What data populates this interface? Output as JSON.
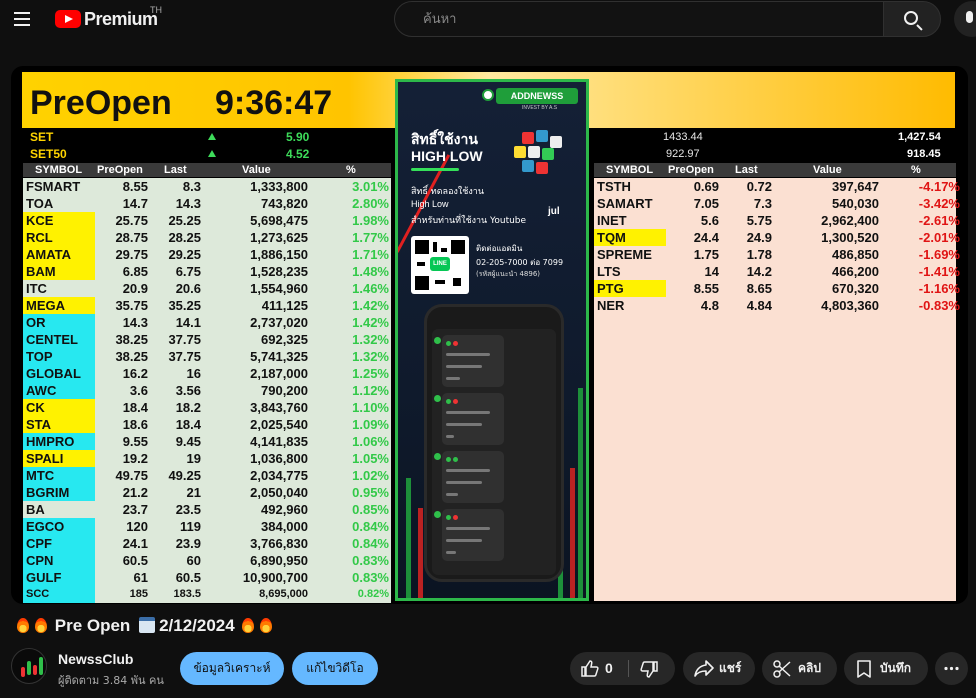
{
  "header": {
    "logo_text": "Premium",
    "region": "TH",
    "search_placeholder": "ค้นหา"
  },
  "video": {
    "banner_title": "PreOpen",
    "banner_time": "9:36:47",
    "indices": [
      {
        "name": "SET",
        "change": "5.90",
        "value": "1433.44",
        "close": "1,427.54"
      },
      {
        "name": "SET50",
        "change": "4.52",
        "value": "922.97",
        "close": "918.45"
      }
    ],
    "columns": [
      "SYMBOL",
      "PreOpen",
      "Last",
      "Value",
      "%"
    ],
    "gainers": [
      {
        "s": "FSMART",
        "p": "8.55",
        "l": "8.3",
        "v": "1,333,800",
        "c": "3.01%",
        "h": ""
      },
      {
        "s": "TOA",
        "p": "14.7",
        "l": "14.3",
        "v": "743,820",
        "c": "2.80%",
        "h": ""
      },
      {
        "s": "KCE",
        "p": "25.75",
        "l": "25.25",
        "v": "5,698,475",
        "c": "1.98%",
        "h": "yellow"
      },
      {
        "s": "RCL",
        "p": "28.75",
        "l": "28.25",
        "v": "1,273,625",
        "c": "1.77%",
        "h": "yellow"
      },
      {
        "s": "AMATA",
        "p": "29.75",
        "l": "29.25",
        "v": "1,886,150",
        "c": "1.71%",
        "h": "yellow"
      },
      {
        "s": "BAM",
        "p": "6.85",
        "l": "6.75",
        "v": "1,528,235",
        "c": "1.48%",
        "h": "yellow"
      },
      {
        "s": "ITC",
        "p": "20.9",
        "l": "20.6",
        "v": "1,554,960",
        "c": "1.46%",
        "h": ""
      },
      {
        "s": "MEGA",
        "p": "35.75",
        "l": "35.25",
        "v": "411,125",
        "c": "1.42%",
        "h": "yellow"
      },
      {
        "s": "OR",
        "p": "14.3",
        "l": "14.1",
        "v": "2,737,020",
        "c": "1.42%",
        "h": "cyan"
      },
      {
        "s": "CENTEL",
        "p": "38.25",
        "l": "37.75",
        "v": "692,325",
        "c": "1.32%",
        "h": "cyan"
      },
      {
        "s": "TOP",
        "p": "38.25",
        "l": "37.75",
        "v": "5,741,325",
        "c": "1.32%",
        "h": "cyan"
      },
      {
        "s": "GLOBAL",
        "p": "16.2",
        "l": "16",
        "v": "2,187,000",
        "c": "1.25%",
        "h": "cyan"
      },
      {
        "s": "AWC",
        "p": "3.6",
        "l": "3.56",
        "v": "790,200",
        "c": "1.12%",
        "h": "cyan"
      },
      {
        "s": "CK",
        "p": "18.4",
        "l": "18.2",
        "v": "3,843,760",
        "c": "1.10%",
        "h": "yellow"
      },
      {
        "s": "STA",
        "p": "18.6",
        "l": "18.4",
        "v": "2,025,540",
        "c": "1.09%",
        "h": "yellow"
      },
      {
        "s": "HMPRO",
        "p": "9.55",
        "l": "9.45",
        "v": "4,141,835",
        "c": "1.06%",
        "h": "cyan"
      },
      {
        "s": "SPALI",
        "p": "19.2",
        "l": "19",
        "v": "1,036,800",
        "c": "1.05%",
        "h": "yellow"
      },
      {
        "s": "MTC",
        "p": "49.75",
        "l": "49.25",
        "v": "2,034,775",
        "c": "1.02%",
        "h": "cyan"
      },
      {
        "s": "BGRIM",
        "p": "21.2",
        "l": "21",
        "v": "2,050,040",
        "c": "0.95%",
        "h": "cyan"
      },
      {
        "s": "BA",
        "p": "23.7",
        "l": "23.5",
        "v": "492,960",
        "c": "0.85%",
        "h": ""
      },
      {
        "s": "EGCO",
        "p": "120",
        "l": "119",
        "v": "384,000",
        "c": "0.84%",
        "h": "cyan"
      },
      {
        "s": "CPF",
        "p": "24.1",
        "l": "23.9",
        "v": "3,766,830",
        "c": "0.84%",
        "h": "cyan"
      },
      {
        "s": "CPN",
        "p": "60.5",
        "l": "60",
        "v": "6,890,950",
        "c": "0.83%",
        "h": "cyan"
      },
      {
        "s": "GULF",
        "p": "61",
        "l": "60.5",
        "v": "10,900,700",
        "c": "0.83%",
        "h": "cyan"
      },
      {
        "s": "SCC",
        "p": "185",
        "l": "183.5",
        "v": "8,695,000",
        "c": "0.82%",
        "h": "cyan"
      }
    ],
    "losers": [
      {
        "s": "TSTH",
        "p": "0.69",
        "l": "0.72",
        "v": "397,647",
        "c": "-4.17%",
        "h": ""
      },
      {
        "s": "SAMART",
        "p": "7.05",
        "l": "7.3",
        "v": "540,030",
        "c": "-3.42%",
        "h": ""
      },
      {
        "s": "INET",
        "p": "5.6",
        "l": "5.75",
        "v": "2,962,400",
        "c": "-2.61%",
        "h": ""
      },
      {
        "s": "TQM",
        "p": "24.4",
        "l": "24.9",
        "v": "1,300,520",
        "c": "-2.01%",
        "h": "yellow"
      },
      {
        "s": "SPREME",
        "p": "1.75",
        "l": "1.78",
        "v": "486,850",
        "c": "-1.69%",
        "h": ""
      },
      {
        "s": "LTS",
        "p": "14",
        "l": "14.2",
        "v": "466,200",
        "c": "-1.41%",
        "h": ""
      },
      {
        "s": "PTG",
        "p": "8.55",
        "l": "8.65",
        "v": "670,320",
        "c": "-1.16%",
        "h": "yellow"
      },
      {
        "s": "NER",
        "p": "4.8",
        "l": "4.84",
        "v": "4,803,360",
        "c": "-0.83%",
        "h": ""
      }
    ],
    "ad": {
      "brand": "ADDNEWSS",
      "brand_sub": "INVEST BY A.S",
      "headline_1": "สิทธิ์ใช้งาน",
      "headline_2": "HIGH LOW",
      "text_1": "สิทธิ์ ทดลองใช้งาน",
      "text_2": "High Low",
      "text_3": "สำหรับท่านที่ใช้งาน Youtube",
      "text_jul": "jul",
      "qr_badge": "LINE",
      "contact_1": "ติดต่อแอดมิน",
      "contact_2": "02-205-7000 ต่อ 7099",
      "contact_3": "(รหัสผู้แนะนำ 4896)"
    }
  },
  "title": {
    "text": "Pre Open",
    "date": "2/12/2024"
  },
  "channel": {
    "name": "NewssClub",
    "subscribers": "ผู้ติดตาม 3.84 พัน คน",
    "btn_analysis": "ข้อมูลวิเคราะห์",
    "btn_edit": "แก้ไขวิดีโอ"
  },
  "actions": {
    "likes": "0",
    "share": "แชร์",
    "clip": "คลิป",
    "save": "บันทึก"
  },
  "colors": {
    "gain": "#32c948",
    "loss": "#e01414",
    "row_yellow": "#fff200",
    "row_cyan": "#27e8f0",
    "gain_row_bg": "#dde9da",
    "loss_row_bg": "#fbe0d2",
    "pill_blue": "#65b8ff"
  }
}
